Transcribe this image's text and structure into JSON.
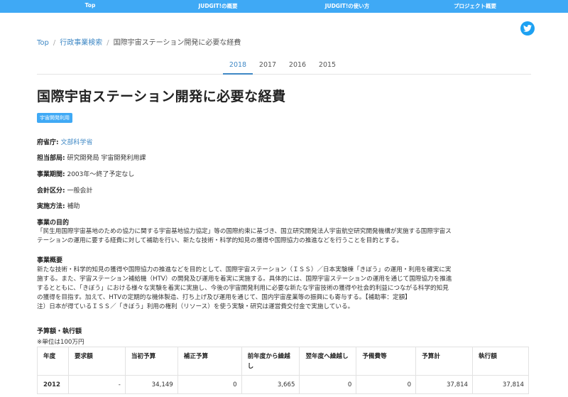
{
  "topnav": {
    "items": [
      "Top",
      "JUDGIT!の概要",
      "JUDGIT!の使い方",
      "プロジェクト概要"
    ]
  },
  "breadcrumb": {
    "items": [
      "Top",
      "行政事業検索",
      "国際宇宙ステーション開発に必要な経費"
    ]
  },
  "tabs": [
    "2018",
    "2017",
    "2016",
    "2015"
  ],
  "page": {
    "title": "国際宇宙ステーション開発に必要な経費",
    "tag": "宇宙開発利用"
  },
  "fields": {
    "ministry_label": "府省庁:",
    "ministry_value": "文部科学省",
    "dept_label": "担当部局:",
    "dept_value": "研究開発局 宇宙開発利用課",
    "period_label": "事業期間:",
    "period_value": "2003年〜終了予定なし",
    "account_label": "会計区分:",
    "account_value": "一般会計",
    "method_label": "実施方法:",
    "method_value": "補助"
  },
  "purpose": {
    "heading": "事業の目的",
    "lines": [
      "「民生用国際宇宙基地のための協力に関する宇宙基地協力協定」等の国際約束に基づき、国立研究開発法人宇宙航空研究開発機構が実施する国際宇宙ス",
      "テーションの運用に要する経費に対して補助を行い、新たな技術・科学的知見の獲得や国際協力の推進などを行うことを目的とする。"
    ]
  },
  "overview": {
    "heading": "事業概要",
    "lines": [
      "新たな技術・科学的知見の獲得や国際協力の推進などを目的として、国際宇宙ステーション（ＩＳＳ）／日本実験棟「きぼう」の運用・利用を確実に実",
      "施する。また、宇宙ステーション補給機（HTV）の開発及び運用を着実に実施する。具体的には、国際宇宙ステーションの運用を通じて国際協力を推進",
      "するとともに、「きぼう」における様々な実験を着実に実施し、今後の宇宙開発利用に必要な新たな宇宙技術の獲得や社会的利益につながる科学的知見",
      "の獲得を目指す。加えて、HTVの定期的な機体製造、打ち上げ及び運用を通じて、国内宇宙産業等の振興にも寄与する。【補助率：定額】",
      "注）日本が得ているＩＳＳ／「きぼう」利用の権利（リソース）を使う実験・研究は運営費交付金で実施している。"
    ]
  },
  "budget": {
    "heading": "予算額・執行額",
    "unit_note": "※単位は100万円",
    "headers": [
      "年度",
      "要求額",
      "当初予算",
      "補正予算",
      "前年度から繰越し",
      "翌年度へ繰越し",
      "予備費等",
      "予算計",
      "執行額"
    ],
    "rows": [
      [
        "2012",
        "-",
        "34,149",
        "0",
        "3,665",
        "0",
        "0",
        "37,814",
        "37,814"
      ]
    ]
  },
  "icons": {
    "twitter": "twitter-icon"
  },
  "colors": {
    "accent": "#3fa9f5",
    "link": "#3f88c5",
    "twitter": "#1da1f2"
  }
}
